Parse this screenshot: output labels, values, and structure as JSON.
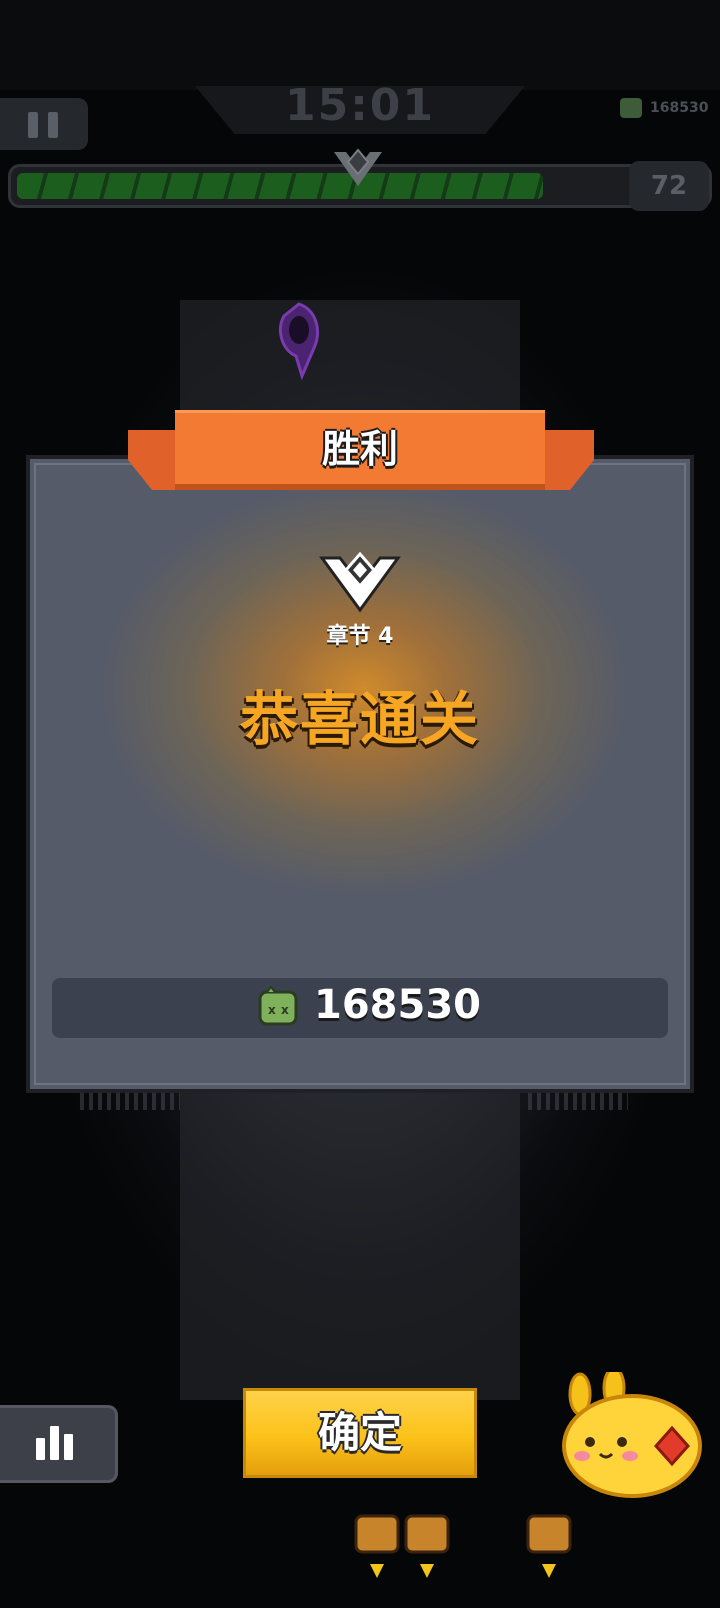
{
  "hud": {
    "timer": "15:01",
    "coins": "168530",
    "level": "72",
    "xp_progress": 0.86
  },
  "result": {
    "banner_title": "胜利",
    "chapter": "章节 4",
    "headline": "恭喜通关",
    "reward_amount": "168530"
  },
  "actions": {
    "confirm_label": "确定"
  },
  "colors": {
    "banner": "#f27a32",
    "headline": "#f6a623",
    "confirm": "#fcc219",
    "xp_fill": "#1b6a1d"
  },
  "icons": [
    "pause-icon",
    "coin-icon",
    "rank-emblem-icon",
    "stats-icon",
    "mascot-icon",
    "chest-icon"
  ]
}
